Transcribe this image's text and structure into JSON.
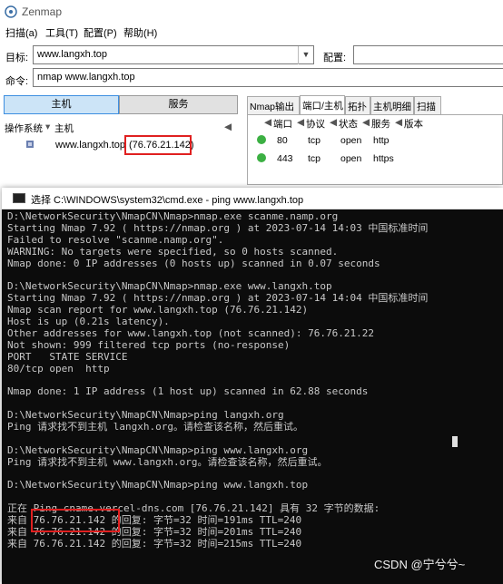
{
  "zenmap": {
    "title": "Zenmap",
    "menu": [
      "扫描(a)",
      "工具(T)",
      "配置(P)",
      "帮助(H)"
    ],
    "target_label": "目标:",
    "target_value": "www.langxh.top",
    "profile_label": "配置:",
    "profile_value": "",
    "command_label": "命令:",
    "command_value": "nmap www.langxh.top",
    "hosts_button": "主机",
    "services_button": "服务",
    "os_col": "操作系统",
    "host_col": "主机",
    "host_entry": "www.langxh.top",
    "host_ip": "(76.76.21.142)",
    "tabs": [
      "Nmap输出",
      "端口/主机",
      "拓扑",
      "主机明细",
      "扫描"
    ],
    "port_headers": [
      "端口",
      "协议",
      "状态",
      "服务",
      "版本"
    ],
    "ports": [
      {
        "port": "80",
        "protocol": "tcp",
        "state": "open",
        "service": "http"
      },
      {
        "port": "443",
        "protocol": "tcp",
        "state": "open",
        "service": "https"
      }
    ]
  },
  "cmd": {
    "title": "选择 C:\\WINDOWS\\system32\\cmd.exe - ping  www.langxh.top",
    "lines": [
      "D:\\NetworkSecurity\\NmapCN\\Nmap>nmap.exe scanme.namp.org",
      "Starting Nmap 7.92 ( https://nmap.org ) at 2023-07-14 14:03 中国标准时间",
      "Failed to resolve \"scanme.namp.org\".",
      "WARNING: No targets were specified, so 0 hosts scanned.",
      "Nmap done: 0 IP addresses (0 hosts up) scanned in 0.07 seconds",
      "",
      "D:\\NetworkSecurity\\NmapCN\\Nmap>nmap.exe www.langxh.top",
      "Starting Nmap 7.92 ( https://nmap.org ) at 2023-07-14 14:04 中国标准时间",
      "Nmap scan report for www.langxh.top (76.76.21.142)",
      "Host is up (0.21s latency).",
      "Other addresses for www.langxh.top (not scanned): 76.76.21.22",
      "Not shown: 999 filtered tcp ports (no-response)",
      "PORT   STATE SERVICE",
      "80/tcp open  http",
      "",
      "Nmap done: 1 IP address (1 host up) scanned in 62.88 seconds",
      "",
      "D:\\NetworkSecurity\\NmapCN\\Nmap>ping langxh.org",
      "Ping 请求找不到主机 langxh.org。请检查该名称，然后重试。",
      "",
      "D:\\NetworkSecurity\\NmapCN\\Nmap>ping www.langxh.org",
      "Ping 请求找不到主机 www.langxh.org。请检查该名称，然后重试。",
      "",
      "D:\\NetworkSecurity\\NmapCN\\Nmap>ping www.langxh.top",
      "",
      "正在 Ping cname.vercel-dns.com [76.76.21.142] 具有 32 字节的数据:",
      "来自 76.76.21.142 的回复: 字节=32 时间=191ms TTL=240",
      "来自 76.76.21.142 的回复: 字节=32 时间=201ms TTL=240",
      "来自 76.76.21.142 的回复: 字节=32 时间=215ms TTL=240"
    ]
  },
  "watermark": "CSDN @宁兮兮~"
}
